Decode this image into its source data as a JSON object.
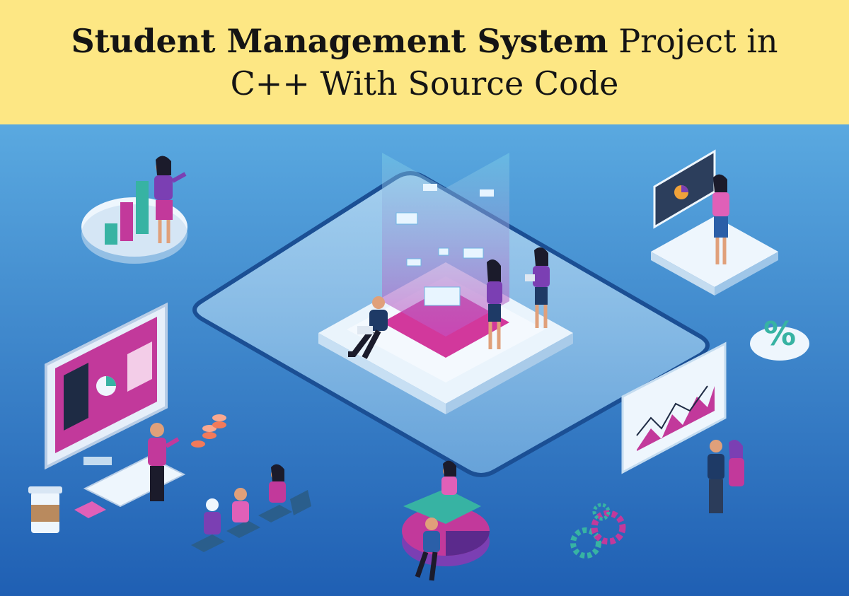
{
  "banner": {
    "title_bold": "Student Management System",
    "title_rest": " Project in",
    "title_line2": "C++ With Source Code"
  },
  "colors": {
    "banner_bg": "#fde784",
    "scene_bg_top": "#5aa9e0",
    "scene_bg_bottom": "#1f5fb3",
    "accent_magenta": "#c2399b",
    "accent_teal": "#37b3a3",
    "accent_purple": "#7b3fb3"
  },
  "illustration": {
    "icons": [
      "bar-chart-icon",
      "dashboard-monitor-icon",
      "percent-icon",
      "line-chart-board-icon",
      "pie-chart-icon",
      "gear-icon",
      "coin-stack-icon",
      "coffee-cup-icon",
      "calculator-icon",
      "keyboard-icon"
    ]
  }
}
